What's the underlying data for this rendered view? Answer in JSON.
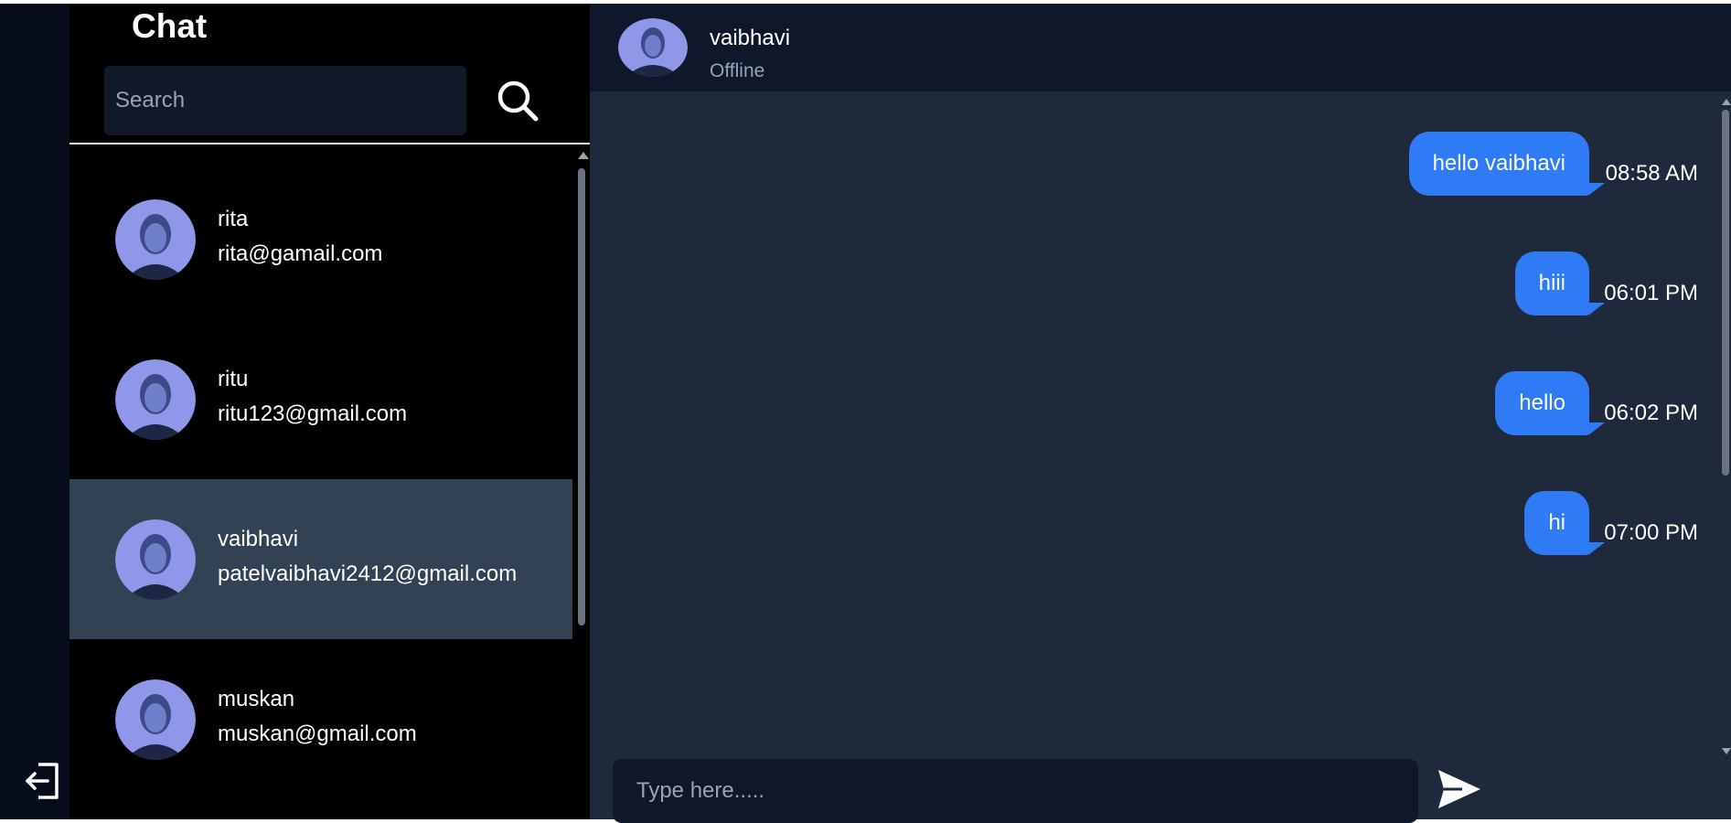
{
  "sidebar": {
    "title": "Chat",
    "search_placeholder": "Search",
    "contacts": [
      {
        "name": "rita",
        "email": "rita@gamail.com",
        "active": false
      },
      {
        "name": "ritu",
        "email": "ritu123@gmail.com",
        "active": false
      },
      {
        "name": "vaibhavi",
        "email": "patelvaibhavi2412@gmail.com",
        "active": true
      },
      {
        "name": "muskan",
        "email": "muskan@gmail.com",
        "active": false
      }
    ]
  },
  "chat": {
    "contact_name": "vaibhavi",
    "status": "Offline",
    "messages": [
      {
        "text": "hello vaibhavi",
        "time": "08:58 AM"
      },
      {
        "text": "hiii",
        "time": "06:01 PM"
      },
      {
        "text": "hello",
        "time": "06:02 PM"
      },
      {
        "text": "hi",
        "time": "07:00 PM"
      }
    ],
    "input_placeholder": "Type here....."
  },
  "icons": {
    "logout": "logout-icon",
    "search": "search-icon",
    "send": "send-icon"
  },
  "colors": {
    "accent": "#2f7bf5",
    "active_row": "#334155",
    "chat_bg": "#1e293b",
    "header_bg": "#0f172a"
  }
}
